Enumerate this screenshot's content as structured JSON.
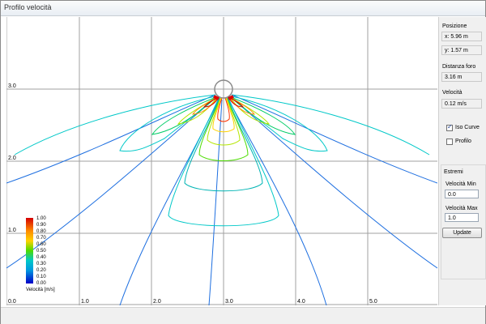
{
  "window": {
    "title": "Profilo velocità"
  },
  "plot": {
    "x_ticks": [
      "0.0",
      "1.0",
      "2.0",
      "3.0",
      "4.0",
      "5.0"
    ],
    "y_ticks": [
      "3.0",
      "2.0",
      "1.0"
    ],
    "colorbar": {
      "title": "Velocità [m/s]",
      "labels": [
        "1.00",
        "0.90",
        "0.80",
        "0.70",
        "0.60",
        "0.50",
        "0.40",
        "0.30",
        "0.20",
        "0.10",
        "0.00"
      ],
      "colors": [
        "#d50000",
        "#ff3300",
        "#ff8c00",
        "#ffd200",
        "#b4e600",
        "#4cdc00",
        "#00cc66",
        "#00c8c8",
        "#0098e0",
        "#0050e6",
        "#0000c8"
      ]
    },
    "line_color": "#1e6fe0",
    "grid_color": "#a0a0a0"
  },
  "panel": {
    "position_label": "Posizione",
    "x_value": "x: 5.96 m",
    "y_value": "y: 1.57 m",
    "distance_label": "Distanza foro",
    "distance_value": "3.16 m",
    "velocity_label": "Velocità",
    "velocity_value": "0.12 m/s",
    "iso_label": "Iso Curve",
    "iso_checked": true,
    "profile_label": "Profilo",
    "profile_checked": false,
    "extremes_label": "Estremi",
    "vmin_label": "Velocità Min",
    "vmin_value": "0.0",
    "vmax_label": "Velocità Max",
    "vmax_value": "1.0",
    "update_label": "Update"
  }
}
